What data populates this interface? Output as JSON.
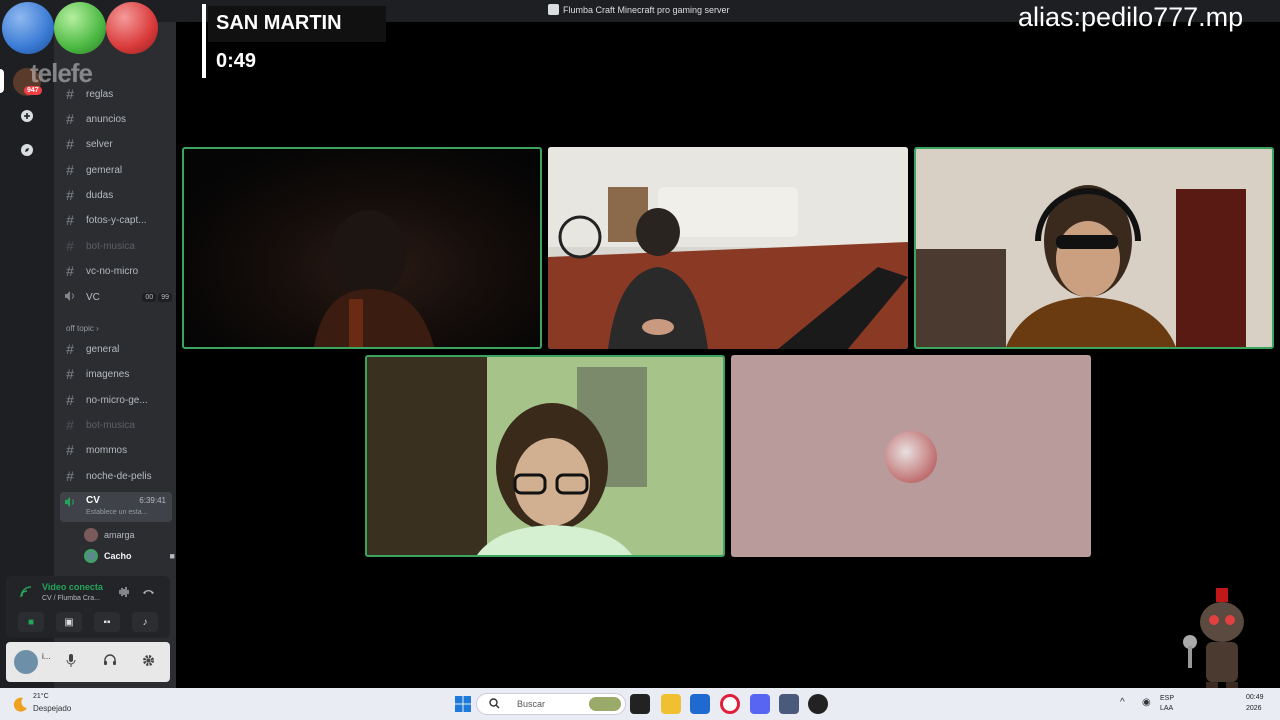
{
  "window": {
    "title": "Flumba Craft Minecraft pro gaming server"
  },
  "overlay": {
    "team": "SAN MARTIN",
    "clock": "0:49",
    "alias": "alias:pedilo777.mp",
    "watermark": "telefe",
    "ball_colors": [
      "#3a7bd5",
      "#4cb944",
      "#d93a3a"
    ]
  },
  "rail": {
    "badge": "947"
  },
  "channels": {
    "items": [
      {
        "name": "reglas",
        "muted": false
      },
      {
        "name": "anuncios",
        "muted": false
      },
      {
        "name": "selver",
        "muted": false
      },
      {
        "name": "gemeral",
        "muted": false
      },
      {
        "name": "dudas",
        "muted": false
      },
      {
        "name": "fotos-y-capt...",
        "muted": false
      },
      {
        "name": "bot-musica",
        "muted": true
      },
      {
        "name": "vc-no-micro",
        "muted": false
      }
    ],
    "vc": {
      "name": "VC",
      "badge_a": "00",
      "badge_b": "99"
    },
    "category": "off topic",
    "offtopic": [
      {
        "name": "general",
        "muted": false
      },
      {
        "name": "imagenes",
        "muted": false
      },
      {
        "name": "no-micro-ge...",
        "muted": false
      },
      {
        "name": "bot-musica",
        "muted": true
      },
      {
        "name": "mommos",
        "muted": false
      },
      {
        "name": "noche-de-pelis",
        "muted": false
      }
    ],
    "cv": {
      "name": "CV",
      "time": "6:39:41",
      "status": "Establece un esta..."
    },
    "members": [
      {
        "name": "amarga"
      },
      {
        "name": "Cacho"
      }
    ]
  },
  "voice_panel": {
    "status": "Video conecta",
    "channel": "CV / Flumba Cra..."
  },
  "user_panel": {
    "name": "i..."
  },
  "taskbar": {
    "temp": "21°C",
    "weather": "Despejado",
    "search_placeholder": "Buscar",
    "lang": "ESP",
    "layout": "LAA",
    "time": "00:49",
    "date": "2026"
  },
  "colors": {
    "speaking": "#3ba55d",
    "sidebar": "#2b2d31",
    "rail": "#1e1f22",
    "voice_connected": "#23a55a"
  }
}
